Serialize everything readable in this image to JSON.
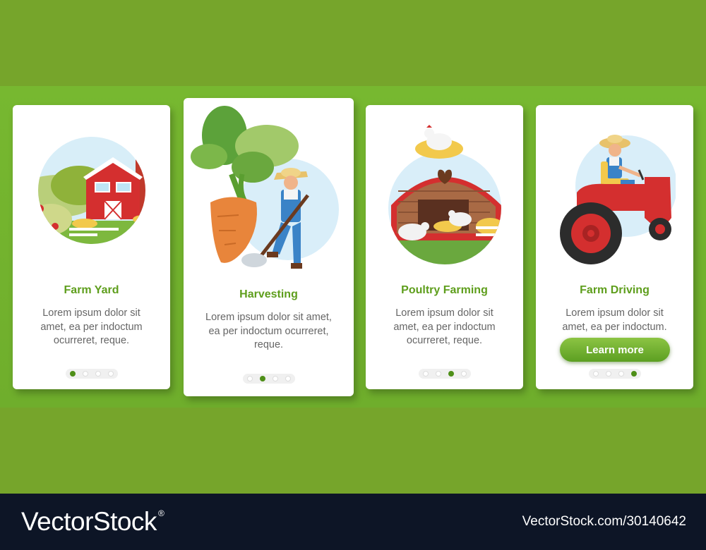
{
  "cards": [
    {
      "title": "Farm Yard",
      "desc": "Lorem ipsum dolor sit amet, ea per indoctum ocurreret, reque.",
      "active_dot": 1
    },
    {
      "title": "Harvesting",
      "desc": "Lorem ipsum dolor sit amet, ea per indoctum ocurreret, reque.",
      "active_dot": 2
    },
    {
      "title": "Poultry Farming",
      "desc": "Lorem ipsum dolor sit amet, ea per indoctum ocurreret, reque.",
      "active_dot": 3
    },
    {
      "title": "Farm Driving",
      "desc": "Lorem ipsum dolor sit amet, ea per indoctum.",
      "button": "Learn more",
      "active_dot": 4
    }
  ],
  "footer": {
    "logo": "VectorStock",
    "registered": "®",
    "image_id": "VectorStock.com/30140642"
  },
  "colors": {
    "accent_green": "#5e9e1c",
    "background_green": "#77b830",
    "footer_navy": "#0d1526"
  }
}
